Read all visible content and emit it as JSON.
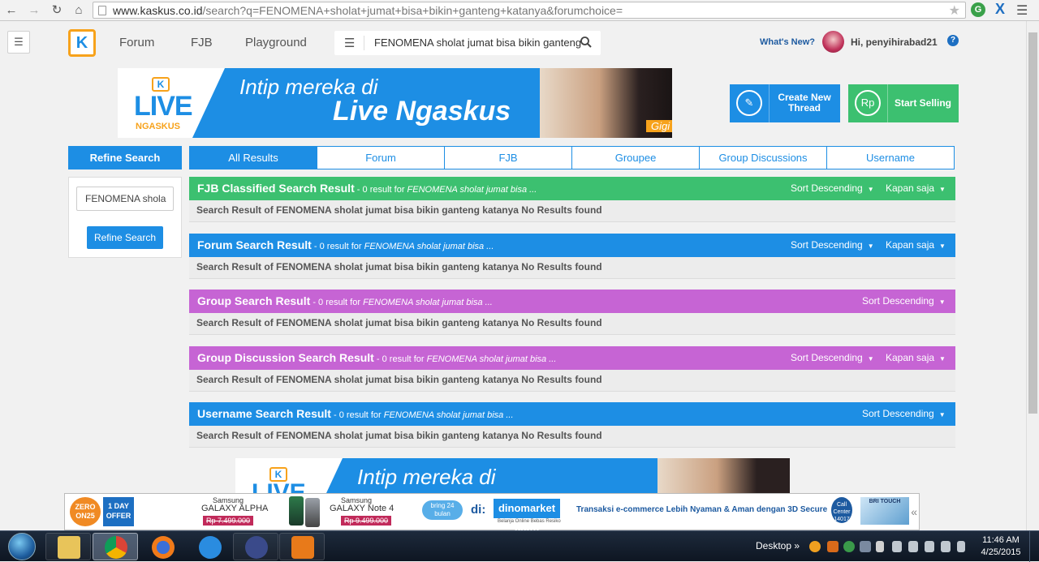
{
  "browser": {
    "url_host": "www.kaskus.co.id",
    "url_rest": "/search?q=FENOMENA+sholat+jumat+bisa+bikin+ganteng+katanya&forumchoice="
  },
  "header": {
    "nav": [
      "Forum",
      "FJB",
      "Playground"
    ],
    "search_value": "FENOMENA sholat jumat bisa bikin ganteng",
    "whats_new": "What's New?",
    "greeting": "Hi, penyihirabad21",
    "help": "?"
  },
  "banner": {
    "logo_live": "LIVE",
    "logo_sub": "NGASKUS",
    "line1": "Intip mereka di",
    "line2": "Live Ngaskus",
    "tag": "Gigi"
  },
  "actions": {
    "create_thread": "Create New Thread",
    "start_selling": "Start Selling",
    "sell_icon": "Rp"
  },
  "refine": {
    "title": "Refine Search",
    "input_value": "FENOMENA shola",
    "button": "Refine Search"
  },
  "tabs": [
    "All Results",
    "Forum",
    "FJB",
    "Groupee",
    "Group Discussions",
    "Username"
  ],
  "sections": [
    {
      "title": "FJB Classified Search Result",
      "count": " - 0 result for ",
      "query": "FENOMENA sholat jumat bisa ...",
      "sort": "Sort Descending",
      "time": "Kapan saja",
      "body": "Search Result of FENOMENA sholat jumat bisa bikin ganteng katanya No Results found",
      "color": "#3cc070"
    },
    {
      "title": "Forum Search Result",
      "count": " - 0 result for ",
      "query": "FENOMENA sholat jumat bisa ...",
      "sort": "Sort Descending",
      "time": "Kapan saja",
      "body": "Search Result of FENOMENA sholat jumat bisa bikin ganteng katanya No Results found",
      "color": "#1d8ee4"
    },
    {
      "title": "Group Search Result",
      "count": " - 0 result for ",
      "query": "FENOMENA sholat jumat bisa ...",
      "sort": "Sort Descending",
      "body": "Search Result of FENOMENA sholat jumat bisa bikin ganteng katanya No Results found",
      "color": "#c664d4"
    },
    {
      "title": "Group Discussion Search Result",
      "count": " - 0 result for ",
      "query": "FENOMENA sholat jumat bisa ...",
      "sort": "Sort Descending",
      "time": "Kapan saja",
      "body": "Search Result of FENOMENA sholat jumat bisa bikin ganteng katanya No Results found",
      "color": "#c664d4"
    },
    {
      "title": "Username Search Result",
      "count": " - 0 result for ",
      "query": "FENOMENA sholat jumat bisa ...",
      "sort": "Sort Descending",
      "body": "Search Result of FENOMENA sholat jumat bisa bikin ganteng katanya No Results found",
      "color": "#1d8ee4"
    }
  ],
  "ad": {
    "zero": "ZERO ON25",
    "day_offer": "1 DAY OFFER",
    "p1_brand": "Samsung",
    "p1_model": "GALAXY ALPHA",
    "p1_price": "Rp 7.499.000",
    "p2_brand": "Samsung",
    "p2_model": "GALAXY Note 4",
    "p2_price": "Rp 9.499.000",
    "bring": "bring 24 bulan",
    "di": "di:",
    "store": "dinomarket .com",
    "store_sub": "Belanja Online Bebas Resiko",
    "tagline": "Transaksi e-commerce Lebih Nyaman & Aman dengan 3D Secure",
    "callcenter": "Call Center 14017",
    "bri": "BRI TOUCH",
    "arrow": "«"
  },
  "taskbar": {
    "desktop": "Desktop",
    "chevron": "»",
    "time": "11:46 AM",
    "date": "4/25/2015"
  }
}
